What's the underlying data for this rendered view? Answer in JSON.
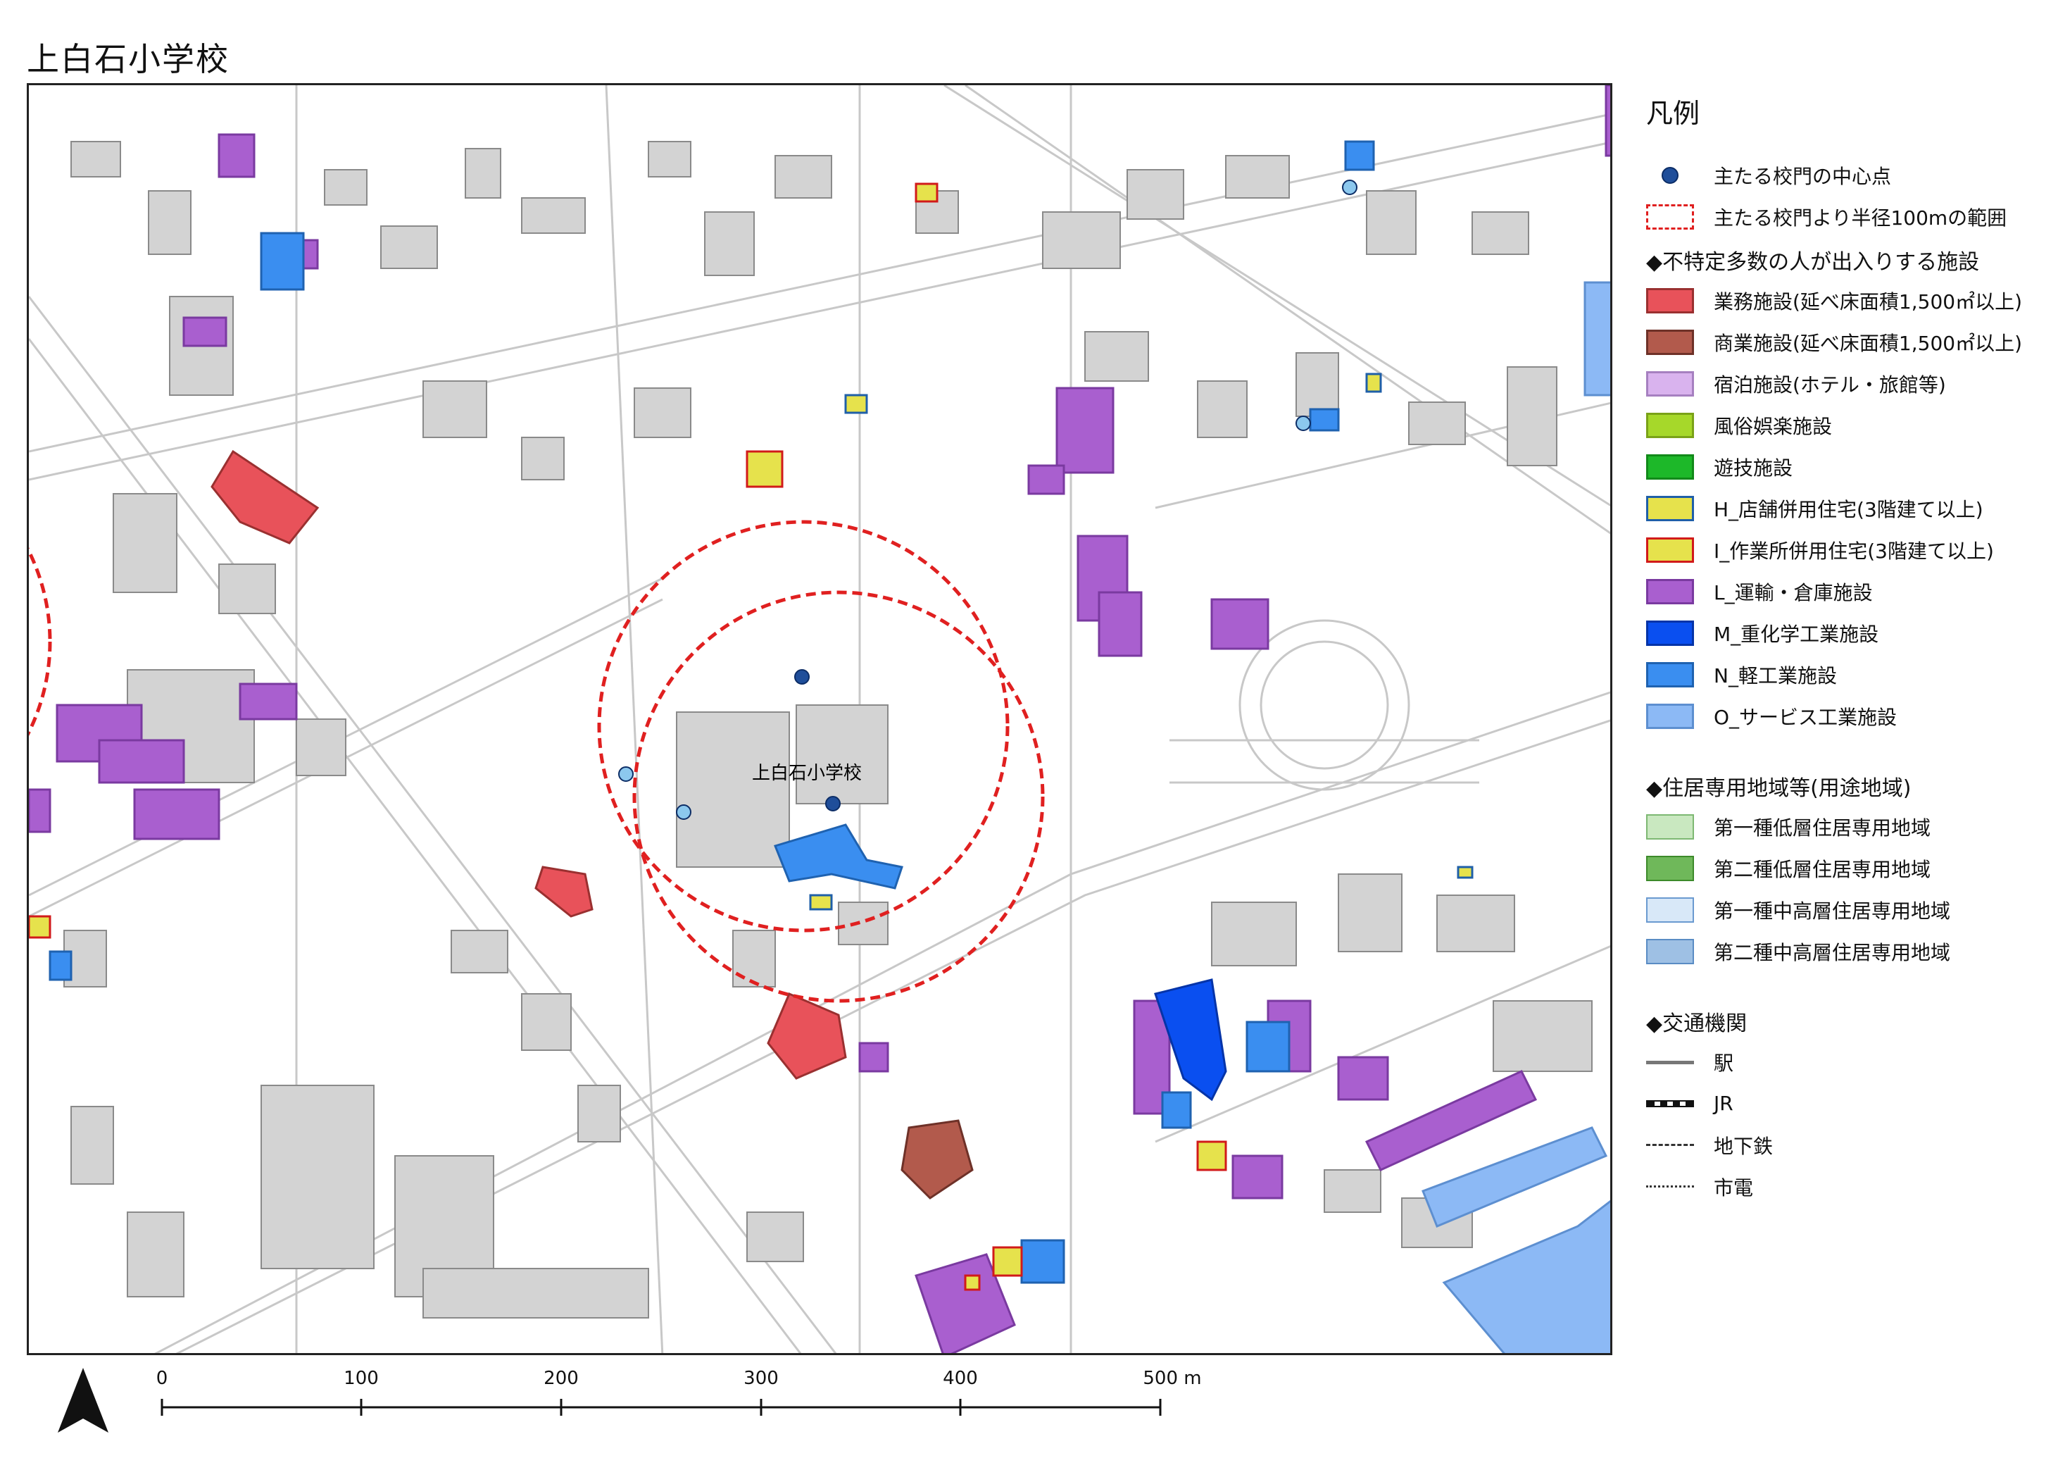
{
  "title": "上白石小学校",
  "map": {
    "school_label": "上白石小学校",
    "radius_color": "#e02020",
    "gate_color": "#1f4e9a"
  },
  "legend": {
    "title": "凡例",
    "items": [
      {
        "label": "主たる校門の中心点",
        "symbol": "dot"
      },
      {
        "label": "主たる校門より半径100mの範囲",
        "symbol": "dashed-box"
      }
    ],
    "section_facilities": "◆不特定多数の人が出入りする施設",
    "facilities": [
      {
        "label": "業務施設(延べ床面積1,500㎡以上)",
        "fill": "#e8525a",
        "stroke": "#9a3030"
      },
      {
        "label": "商業施設(延べ床面積1,500㎡以上)",
        "fill": "#b25a4c",
        "stroke": "#6e3128"
      },
      {
        "label": "宿泊施設(ホテル・旅館等)",
        "fill": "#d9b3ee",
        "stroke": "#a680c0"
      },
      {
        "label": "風俗娯楽施設",
        "fill": "#a6d82a",
        "stroke": "#7aa218"
      },
      {
        "label": "遊技施設",
        "fill": "#1db829",
        "stroke": "#128a1a"
      },
      {
        "label": "H_店舗併用住宅(3階建て以上)",
        "fill": "#e6e24c",
        "stroke": "#1f5fa8"
      },
      {
        "label": "I_作業所併用住宅(3階建て以上)",
        "fill": "#e6e24c",
        "stroke": "#d11a1a"
      },
      {
        "label": "L_運輸・倉庫施設",
        "fill": "#a95fcf",
        "stroke": "#7a3aa0"
      },
      {
        "label": "M_重化学工業施設",
        "fill": "#0a4ff0",
        "stroke": "#0534a8"
      },
      {
        "label": "N_軽工業施設",
        "fill": "#3a8ef0",
        "stroke": "#1f62b0"
      },
      {
        "label": "O_サービス工業施設",
        "fill": "#8cb9f5",
        "stroke": "#5d8fd0"
      }
    ],
    "section_residential": "◆住居専用地域等(用途地域)",
    "residential": [
      {
        "label": "第一種低層住居専用地域",
        "fill": "#c9e8c0",
        "stroke": "#7db872"
      },
      {
        "label": "第二種低層住居専用地域",
        "fill": "#6fb85a",
        "stroke": "#3c8a2a"
      },
      {
        "label": "第一種中高層住居専用地域",
        "fill": "#d8e8f8",
        "stroke": "#6a9ad0"
      },
      {
        "label": "第二種中高層住居専用地域",
        "fill": "#9ec0e4",
        "stroke": "#5a8cc4"
      }
    ],
    "section_transport": "◆交通機関",
    "transport": [
      {
        "label": "駅",
        "style": "solid"
      },
      {
        "label": "JR",
        "style": "rail"
      },
      {
        "label": "地下鉄",
        "style": "dash"
      },
      {
        "label": "市電",
        "style": "dot"
      }
    ]
  },
  "scale": {
    "ticks": [
      "0",
      "100",
      "200",
      "300",
      "400",
      "500 m"
    ]
  }
}
